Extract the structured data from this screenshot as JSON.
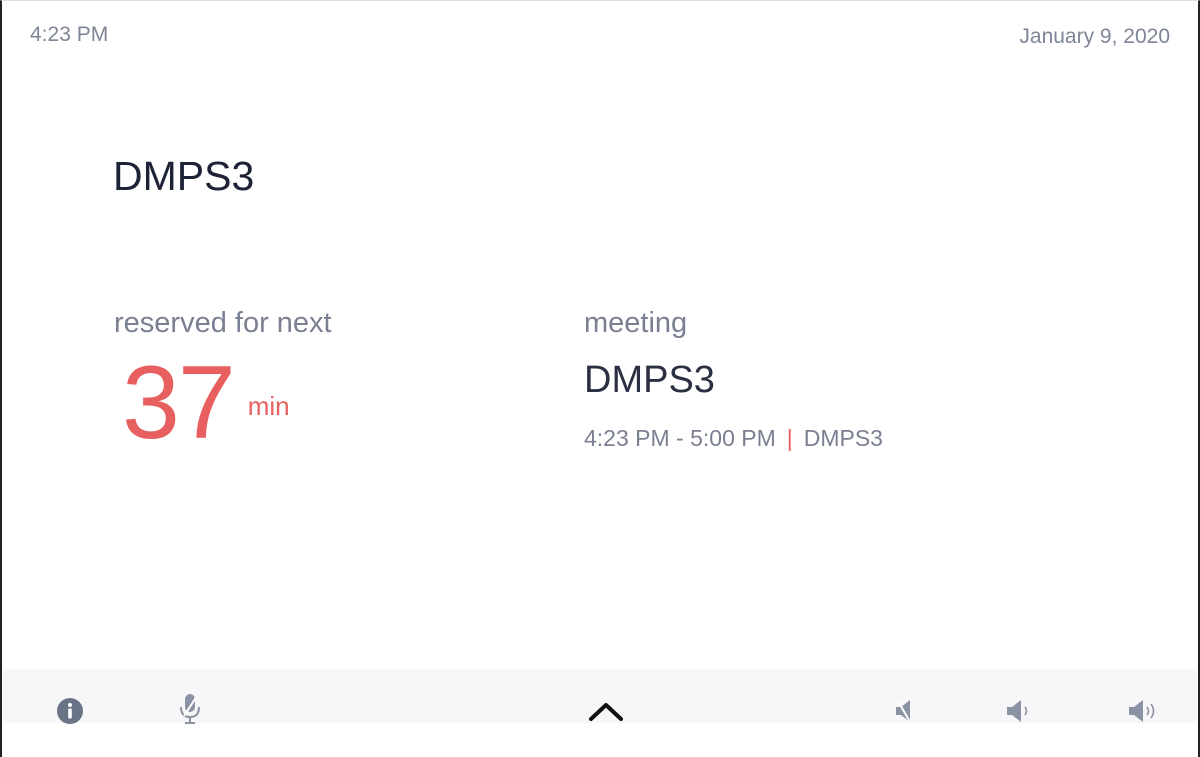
{
  "status_bar": {
    "time": "4:23 PM",
    "date": "January 9, 2020"
  },
  "room": {
    "name": "DMPS3"
  },
  "reservation": {
    "label": "reserved for next",
    "minutes": "37",
    "unit": "min"
  },
  "meeting": {
    "label": "meeting",
    "title": "DMPS3",
    "time_range": "4:23 PM - 5:00 PM",
    "separator": "|",
    "location": "DMPS3"
  },
  "footer": {
    "icons": [
      "info-icon",
      "mic-muted-icon",
      "chevron-up-icon",
      "speaker-mute-icon",
      "volume-down-icon",
      "volume-up-icon"
    ]
  },
  "colors": {
    "accent": "#e85f5f",
    "text_dark": "#1e2236",
    "text_muted": "#7a8092",
    "icon": "#6b7386"
  }
}
